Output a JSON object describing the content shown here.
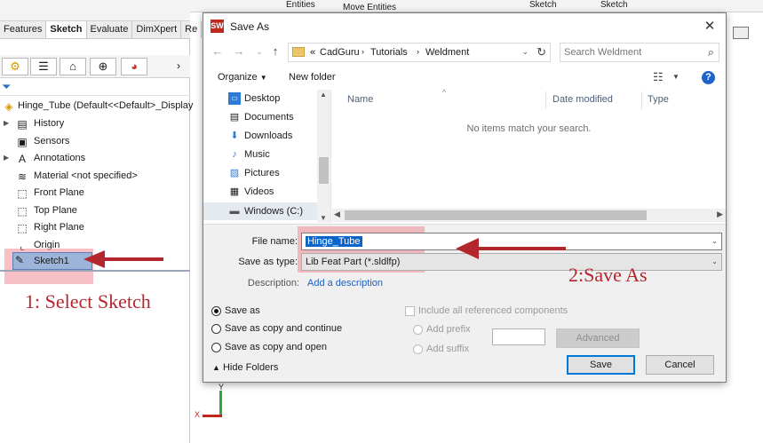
{
  "cad": {
    "toolbar_top": [
      "Entities",
      "Move Entities",
      "Sketch",
      "Sketch"
    ],
    "tabs": [
      "Features",
      "Sketch",
      "Evaluate",
      "DimXpert",
      "Re"
    ],
    "active_tab": "Sketch",
    "tree": {
      "root": "Hinge_Tube  (Default<<Default>_Display",
      "items": [
        "History",
        "Sensors",
        "Annotations",
        "Material <not specified>",
        "Front Plane",
        "Top Plane",
        "Right Plane",
        "Origin",
        "Sketch1"
      ],
      "selected": "Sketch1"
    },
    "annotation_1": "1: Select Sketch",
    "annotation_2": "2:Save As",
    "axis_x": "X",
    "axis_y": "Y"
  },
  "dialog": {
    "title": "Save As",
    "address": {
      "prefix": "«",
      "crumbs": [
        "CadGuru",
        "Tutorials",
        "Weldment"
      ]
    },
    "search_placeholder": "Search Weldment",
    "organize": "Organize",
    "new_folder": "New folder",
    "nav_items": [
      "Desktop",
      "Documents",
      "Downloads",
      "Music",
      "Pictures",
      "Videos",
      "Windows (C:)"
    ],
    "nav_selected": "Windows (C:)",
    "columns": [
      "Name",
      "Date modified",
      "Type"
    ],
    "empty_message": "No items match your search.",
    "file_name_label": "File name:",
    "file_name_value": "Hinge_Tube",
    "save_as_type_label": "Save as type:",
    "save_as_type_value": "Lib Feat Part (*.sldlfp)",
    "description_label": "Description:",
    "description_link": "Add a description",
    "save_options": [
      "Save as",
      "Save as copy and continue",
      "Save as copy and open"
    ],
    "save_option_selected": "Save as",
    "include_referenced": "Include all referenced components",
    "add_prefix": "Add prefix",
    "add_suffix": "Add suffix",
    "advanced": "Advanced",
    "save": "Save",
    "cancel": "Cancel",
    "hide_folders": "Hide Folders"
  },
  "colors": {
    "accent": "#0078d7",
    "annotation": "#b3262e",
    "selection": "#0a64c9"
  }
}
